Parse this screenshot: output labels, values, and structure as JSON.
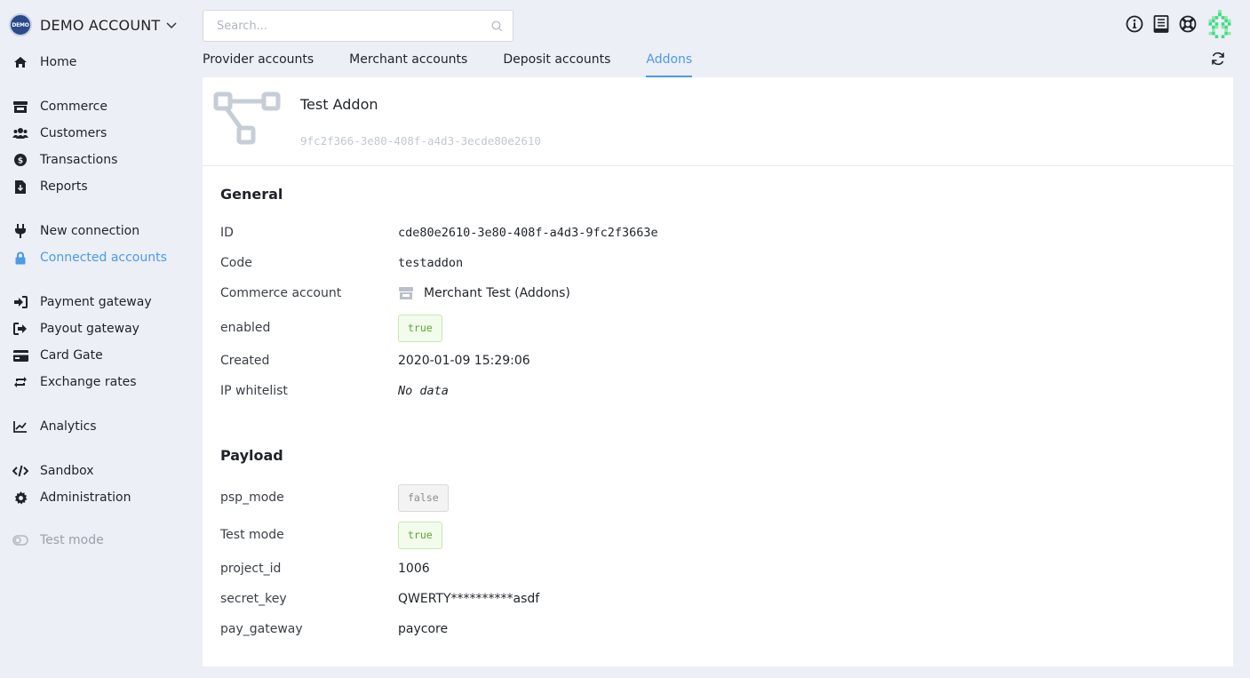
{
  "account": {
    "logo_text": "DEMO",
    "name": "DEMO ACCOUNT"
  },
  "sidebar": {
    "items": [
      {
        "label": "Home",
        "icon": "home-icon"
      },
      {
        "label": "Commerce",
        "icon": "store-icon"
      },
      {
        "label": "Customers",
        "icon": "users-icon"
      },
      {
        "label": "Transactions",
        "icon": "dollar-circle-icon"
      },
      {
        "label": "Reports",
        "icon": "file-download-icon"
      },
      {
        "label": "New connection",
        "icon": "plug-icon"
      },
      {
        "label": "Connected accounts",
        "icon": "lock-icon"
      },
      {
        "label": "Payment gateway",
        "icon": "sign-in-icon"
      },
      {
        "label": "Payout gateway",
        "icon": "sign-out-icon"
      },
      {
        "label": "Card Gate",
        "icon": "credit-card-icon"
      },
      {
        "label": "Exchange rates",
        "icon": "exchange-icon"
      },
      {
        "label": "Analytics",
        "icon": "chart-line-icon"
      },
      {
        "label": "Sandbox",
        "icon": "code-icon"
      },
      {
        "label": "Administration",
        "icon": "gear-icon"
      },
      {
        "label": "Test mode",
        "icon": "toggle-off-icon"
      }
    ]
  },
  "search": {
    "placeholder": "Search..."
  },
  "tabs": [
    {
      "label": "Provider accounts"
    },
    {
      "label": "Merchant accounts"
    },
    {
      "label": "Deposit accounts"
    },
    {
      "label": "Addons"
    }
  ],
  "addon": {
    "title": "Test Addon",
    "uuid": "9fc2f366-3e80-408f-a4d3-3ecde80e2610"
  },
  "general": {
    "title": "General",
    "id_label": "ID",
    "id_value": "cde80e2610-3e80-408f-a4d3-9fc2f3663e",
    "code_label": "Code",
    "code_value": "testaddon",
    "commerce_label": "Commerce account",
    "commerce_value": "Merchant Test (Addons)",
    "enabled_label": "enabled",
    "enabled_value": "true",
    "created_label": "Created",
    "created_value": "2020-01-09 15:29:06",
    "ip_label": "IP whitelist",
    "ip_value": "No data"
  },
  "payload": {
    "title": "Payload",
    "psp_label": "psp_mode",
    "psp_value": "false",
    "test_label": "Test mode",
    "test_value": "true",
    "project_label": "project_id",
    "project_value": "1006",
    "secret_label": "secret_key",
    "secret_value": "QWERTY**********asdf",
    "gateway_label": "pay_gateway",
    "gateway_value": "paycore"
  },
  "colors": {
    "accent": "#4a9be8",
    "true_badge": "#5aa832",
    "brand_logo": "#2a4a8a"
  }
}
